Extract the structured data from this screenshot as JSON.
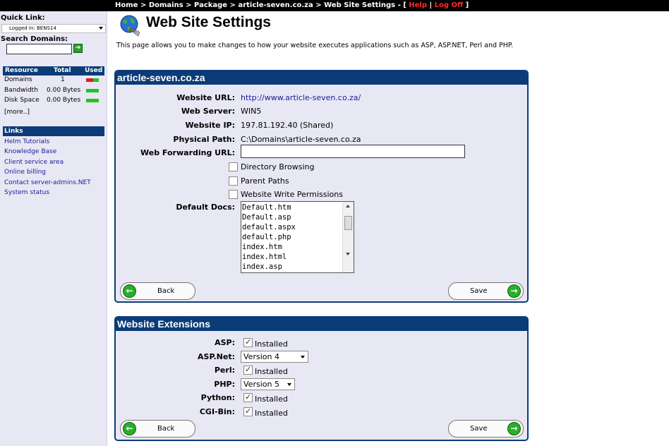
{
  "breadcrumb": {
    "home": "Home",
    "domains": "Domains",
    "package": "Package",
    "domain": "article-seven.co.za",
    "current": "Web Site Settings",
    "sep": ">",
    "dash": "-",
    "open": "[",
    "help": "Help",
    "pipe": "|",
    "logoff": "Log Off",
    "close": "]"
  },
  "sidebar": {
    "quick_link_label": "Quick Link:",
    "logged_in": "Logged In: BENS14",
    "search_label": "Search Domains:",
    "resources": {
      "headers": [
        "Resource",
        "Total",
        "Used"
      ],
      "rows": [
        {
          "name": "Domains",
          "total": "1",
          "bar": "mixed"
        },
        {
          "name": "Bandwidth",
          "total": "0.00 Bytes",
          "bar": "green"
        },
        {
          "name": "Disk Space",
          "total": "0.00 Bytes",
          "bar": "green"
        }
      ],
      "more": "[more..]"
    },
    "links_heading": "Links",
    "links": [
      "Helm Tutorials",
      "Knowledge Base",
      "Client service area",
      "Online billing",
      "Contact server-admins.NET",
      "System status"
    ]
  },
  "page": {
    "title": "Web Site Settings",
    "intro": "This page allows you to make changes to how your website executes applications such as ASP, ASP.NET, Perl and PHP."
  },
  "site_panel": {
    "heading": "article-seven.co.za",
    "website_url_label": "Website URL:",
    "website_url": "http://www.article-seven.co.za/",
    "web_server_label": "Web Server:",
    "web_server": "WIN5",
    "website_ip_label": "Website IP:",
    "website_ip": "197.81.192.40 (Shared)",
    "physical_path_label": "Physical Path:",
    "physical_path": "C:\\Domains\\article-seven.co.za",
    "forwarding_label": "Web Forwarding URL:",
    "forwarding_value": "",
    "directory_browsing": "Directory Browsing",
    "parent_paths": "Parent Paths",
    "write_permissions": "Website Write Permissions",
    "default_docs_label": "Default Docs:",
    "default_docs": [
      "Default.htm",
      "Default.asp",
      "default.aspx",
      "default.php",
      "index.htm",
      "index.html",
      "index.asp"
    ],
    "back_label": "Back",
    "save_label": "Save"
  },
  "ext_panel": {
    "heading": "Website Extensions",
    "asp_label": "ASP:",
    "aspnet_label": "ASP.Net:",
    "aspnet_value": "Version 4",
    "perl_label": "Perl:",
    "php_label": "PHP:",
    "php_value": "Version 5",
    "python_label": "Python:",
    "cgi_label": "CGI-Bin:",
    "installed": "Installed",
    "back_label": "Back",
    "save_label": "Save"
  },
  "colors": {
    "header_blue": "#0b3c78",
    "panel_bg": "#e8e8f4",
    "accent_red": "#ff2a2a",
    "button_green": "#28b028"
  }
}
